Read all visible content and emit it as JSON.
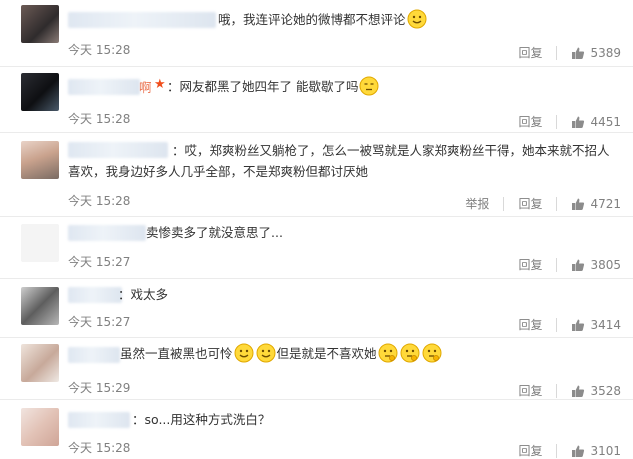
{
  "comments": [
    {
      "text_before": "哦，我连评论她的微博都不想评论",
      "text_after": "",
      "emoji_after": 1,
      "time": "今天 15:28",
      "report": "",
      "reply": "回复",
      "likes": "5389"
    },
    {
      "text_before": "：网友都黑了她四年了 能歇歇了吗",
      "text_after": "",
      "emoji_after": 1,
      "time": "今天 15:28",
      "report": "",
      "reply": "回复",
      "likes": "4451",
      "name_tail": "啊"
    },
    {
      "text_before": "：哎，郑爽粉丝又躺枪了，怎么一被骂就是人家郑爽粉丝干得，她本来就不招人喜欢，我身边好多人几乎全部，不是郑爽粉但都讨厌她",
      "text_after": "",
      "emoji_after": 0,
      "time": "今天 15:28",
      "report": "举报",
      "reply": "回复",
      "likes": "4721"
    },
    {
      "text_before": "卖惨卖多了就没意思了...",
      "text_after": "",
      "emoji_after": 0,
      "time": "今天 15:27",
      "report": "",
      "reply": "回复",
      "likes": "3805"
    },
    {
      "text_before": "：戏太多",
      "text_after": "",
      "emoji_after": 0,
      "time": "今天 15:27",
      "report": "",
      "reply": "回复",
      "likes": "3414"
    },
    {
      "text_before": "虽然一直被黑也可怜",
      "text_after": "但是就是不喜欢她",
      "emoji_after": 0,
      "time": "今天 15:29",
      "report": "",
      "reply": "回复",
      "likes": "3528"
    },
    {
      "text_before": "：so...用这种方式洗白？",
      "text_after": "",
      "emoji_after": 0,
      "time": "今天 15:28",
      "report": "",
      "reply": "回复",
      "likes": "3101"
    }
  ]
}
